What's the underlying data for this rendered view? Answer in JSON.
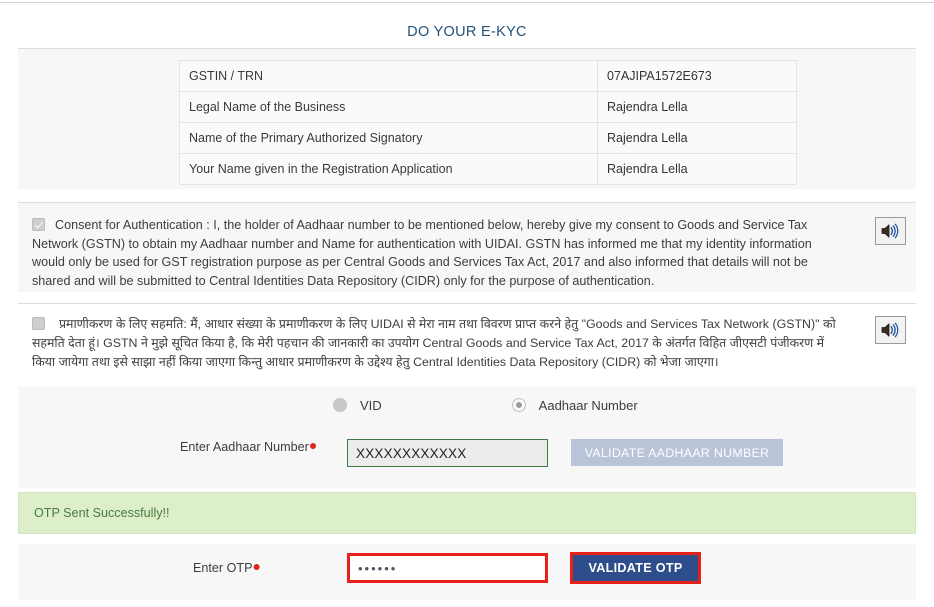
{
  "page": {
    "title": "DO YOUR E-KYC"
  },
  "details_table": {
    "rows": [
      {
        "key": "GSTIN / TRN",
        "value": "07AJIPA1572E673"
      },
      {
        "key": "Legal Name of the Business",
        "value": "Rajendra Lella"
      },
      {
        "key": "Name of the Primary Authorized Signatory",
        "value": "Rajendra Lella"
      },
      {
        "key": "Your Name given in the Registration Application",
        "value": "Rajendra Lella"
      }
    ]
  },
  "consent_en": {
    "checkbox_state": "checked",
    "text": "Consent for Authentication : I, the holder of Aadhaar number to be mentioned below, hereby give my consent to Goods and Service Tax Network (GSTN) to obtain my Aadhaar number and Name for authentication with UIDAI. GSTN has informed me that my identity information would only be used for GST registration purpose as per Central Goods and Services Tax Act, 2017 and also informed that details will not be shared and will be submitted to Central Identities Data Repository (CIDR) only for the purpose of authentication.",
    "speaker_icon": "speaker-icon"
  },
  "consent_hi": {
    "checkbox_state": "unchecked",
    "text": "प्रमाणीकरण के लिए सहमति: मैं, आधार संख्या के प्रमाणीकरण के लिए UIDAI से मेरा नाम तथा विवरण प्राप्त करने हेतु \"Goods and Services Tax Network (GSTN)\" को सहमति देता हूं। GSTN ने मुझे सूचित किया है, कि मेरी पहचान की जानकारी का उपयोग Central Goods and Service Tax Act, 2017 के अंतर्गत विहित जीएसटी पंजीकरण में किया जायेगा तथा इसे साझा नहीं किया जाएगा किन्तु आधार प्रमाणीकरण के उद्देश्य हेतु Central Identities Data Repository (CIDR) को भेजा जाएगा।",
    "speaker_icon": "speaker-icon"
  },
  "id_type": {
    "options": [
      {
        "label": "VID",
        "selected": false
      },
      {
        "label": "Aadhaar Number",
        "selected": true
      }
    ]
  },
  "aadhaar_row": {
    "label": "Enter Aadhaar Number",
    "required_marker": "●",
    "value": "XXXXXXXXXXXX",
    "placeholder": "Enter Aadhaar Number",
    "button_label": "VALIDATE AADHAAR NUMBER"
  },
  "alert": {
    "message": "OTP Sent Successfully!!"
  },
  "otp_row": {
    "label": "Enter OTP",
    "required_marker": "●",
    "value": "••••••",
    "placeholder": "Enter OTP",
    "button_label": "VALIDATE OTP"
  },
  "colors": {
    "title": "#23527c",
    "panel_bg": "#f7f7f7",
    "alert_bg": "#ddeeca",
    "alert_text": "#4a7c3f",
    "primary_button": "#2d4d8b",
    "disabled_button": "#b9c4d8",
    "highlight_border": "#e8201b",
    "input_valid_border": "#3f7a3f",
    "required": "#e32219"
  }
}
